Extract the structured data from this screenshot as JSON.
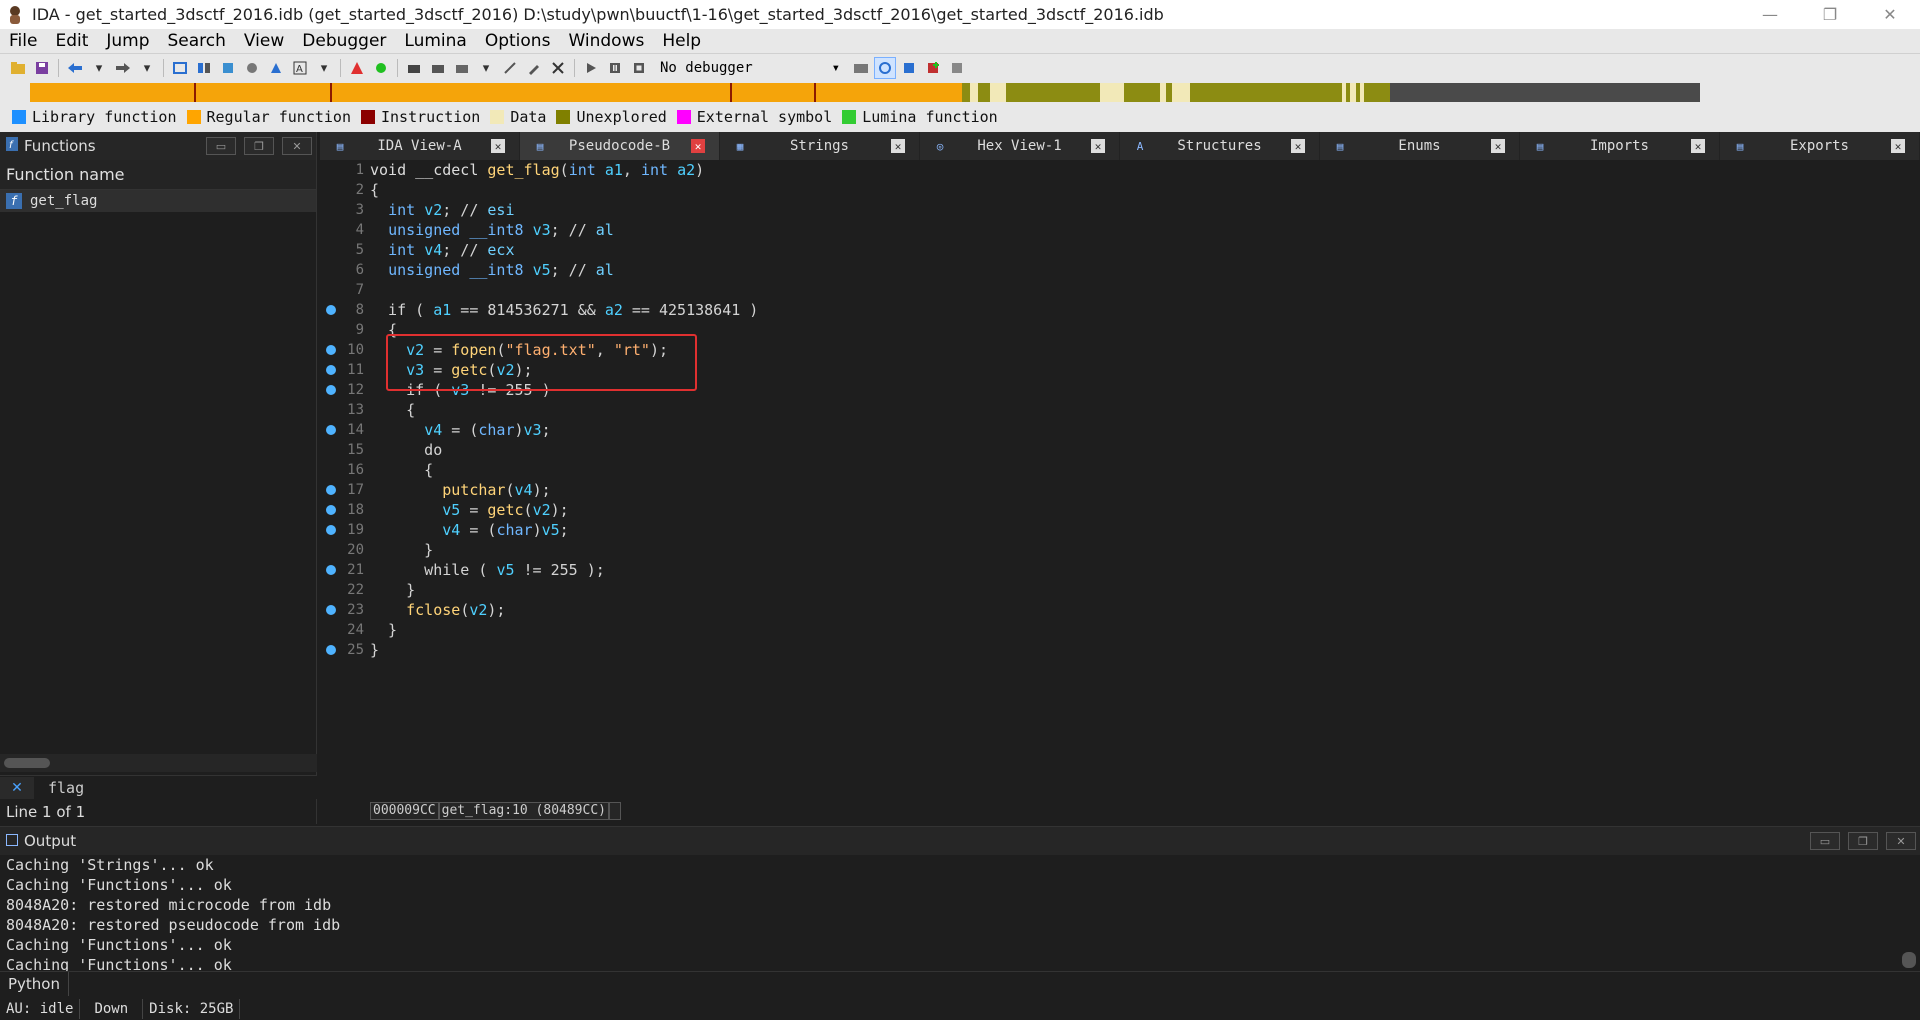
{
  "window": {
    "title": "IDA - get_started_3dsctf_2016.idb (get_started_3dsctf_2016) D:\\study\\pwn\\buuctf\\1-16\\get_started_3dsctf_2016\\get_started_3dsctf_2016.idb",
    "minimize": "—",
    "restore": "❐",
    "close": "✕"
  },
  "menu": [
    "File",
    "Edit",
    "Jump",
    "Search",
    "View",
    "Debugger",
    "Lumina",
    "Options",
    "Windows",
    "Help"
  ],
  "toolbar": {
    "debugger": "No debugger"
  },
  "legend": [
    {
      "label": "Library function",
      "color": "#1e90ff"
    },
    {
      "label": "Regular function",
      "color": "#ffa500"
    },
    {
      "label": "Instruction",
      "color": "#8b0000"
    },
    {
      "label": "Data",
      "color": "#f2e9b8"
    },
    {
      "label": "Unexplored",
      "color": "#808000"
    },
    {
      "label": "External symbol",
      "color": "#ff00ff"
    },
    {
      "label": "Lumina function",
      "color": "#33cc33"
    }
  ],
  "functions_panel": {
    "title": "Functions",
    "column": "Function name",
    "items": [
      "get_flag"
    ],
    "filter": "flag",
    "status": "Line 1 of 1"
  },
  "tabs": [
    {
      "label": "IDA View-A",
      "active": false
    },
    {
      "label": "Pseudocode-B",
      "active": true
    },
    {
      "label": "Strings",
      "active": false
    },
    {
      "label": "Hex View-1",
      "active": false
    },
    {
      "label": "Structures",
      "active": false
    },
    {
      "label": "Enums",
      "active": false
    },
    {
      "label": "Imports",
      "active": false
    },
    {
      "label": "Exports",
      "active": false
    }
  ],
  "code": {
    "lines": [
      "void __cdecl get_flag(int a1, int a2)",
      "{",
      "  int v2; // esi",
      "  unsigned __int8 v3; // al",
      "  int v4; // ecx",
      "  unsigned __int8 v5; // al",
      "",
      "  if ( a1 == 814536271 && a2 == 425138641 )",
      "  {",
      "    v2 = fopen(\"flag.txt\", \"rt\");",
      "    v3 = getc(v2);",
      "    if ( v3 != 255 )",
      "    {",
      "      v4 = (char)v3;",
      "      do",
      "      {",
      "        putchar(v4);",
      "        v5 = getc(v2);",
      "        v4 = (char)v5;",
      "      }",
      "      while ( v5 != 255 );",
      "    }",
      "    fclose(v2);",
      "  }",
      "}"
    ],
    "breakpoints": [
      8,
      10,
      11,
      12,
      14,
      17,
      18,
      19,
      21,
      23,
      25
    ]
  },
  "address_bar": {
    "offset": "000009CC",
    "location": "get_flag:10 (80489CC)"
  },
  "output": {
    "title": "Output",
    "lines": [
      "Caching 'Strings'... ok",
      "Caching 'Functions'... ok",
      "8048A20: restored microcode from idb",
      "8048A20: restored pseudocode from idb",
      "Caching 'Functions'... ok",
      "Caching 'Functions'... ok"
    ]
  },
  "python_label": "Python",
  "status": {
    "au": "AU:  idle",
    "dir": "Down",
    "disk": "Disk: 25GB"
  }
}
